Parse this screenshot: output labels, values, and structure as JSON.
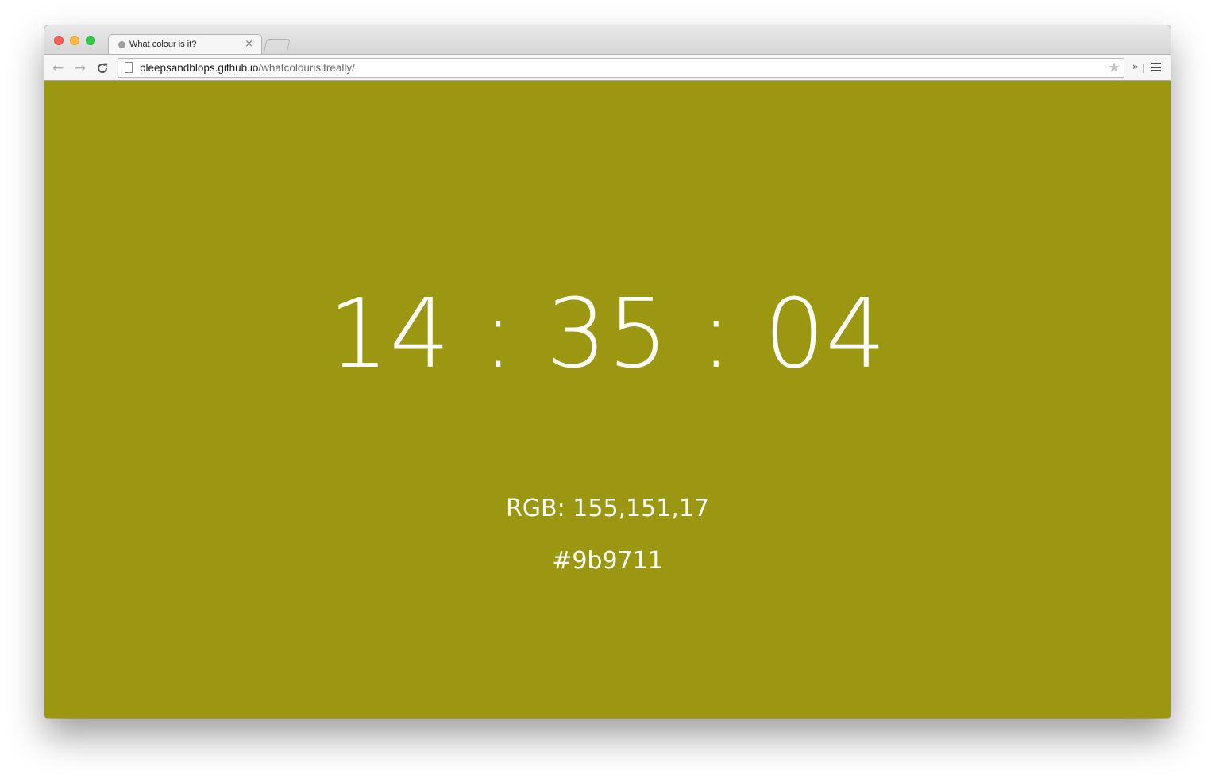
{
  "browser": {
    "tab": {
      "title": "What colour is it?",
      "close_glyph": "×"
    },
    "toolbar": {
      "back_glyph": "←",
      "forward_glyph": "→",
      "reload_glyph": "⟳",
      "url_host": "bleepsandblops.github.io",
      "url_path": "/whatcolourisitreally/",
      "star_glyph": "★",
      "extensions_glyph": "»"
    },
    "icons": [
      "close-traffic-light",
      "minimize-traffic-light",
      "maximize-traffic-light",
      "tab-favicon",
      "tab-close-icon",
      "back-arrow-icon",
      "forward-arrow-icon",
      "reload-icon",
      "page-icon",
      "bookmark-star-icon",
      "extensions-chevron-icon",
      "menu-icon"
    ]
  },
  "page": {
    "background_color": "#9b9711",
    "text_color": "#ffffff",
    "time": {
      "hours": "14",
      "minutes": "35",
      "seconds": "04",
      "separator": ":"
    },
    "rgb_text": "RGB: 155,151,17",
    "hex_text": "#9b9711"
  }
}
